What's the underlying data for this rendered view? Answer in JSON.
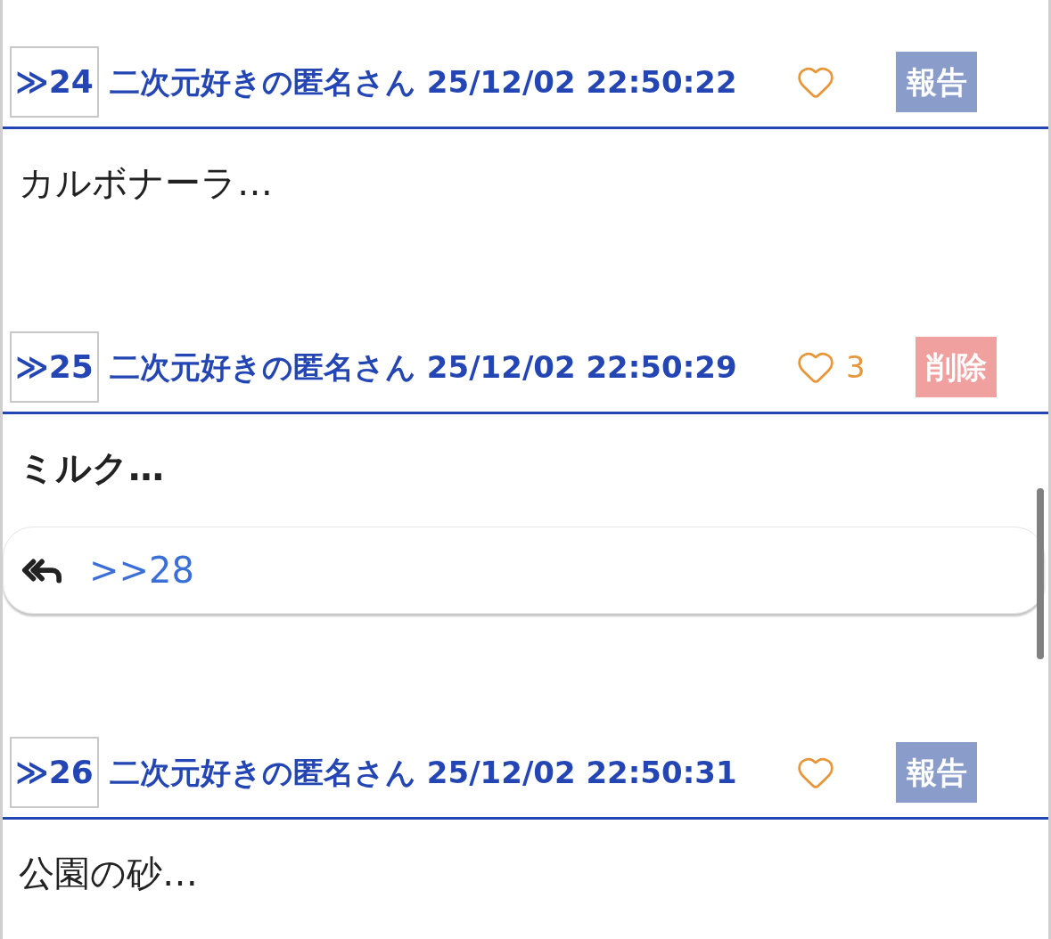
{
  "posts": [
    {
      "number": "≫24",
      "author_time": "二次元好きの匿名さん 25/12/02 22:50:22",
      "action": {
        "kind": "report",
        "label": "報告"
      },
      "body": "カルボナーラ…",
      "bold": false
    },
    {
      "number": "≫25",
      "author_time": "二次元好きの匿名さん 25/12/02 22:50:29",
      "likes": "3",
      "action": {
        "kind": "delete",
        "label": "削除"
      },
      "body": "ミルク…",
      "bold": true,
      "replies": [
        ">>28"
      ]
    },
    {
      "number": "≫26",
      "author_time": "二次元好きの匿名さん 25/12/02 22:50:31",
      "action": {
        "kind": "report",
        "label": "報告"
      },
      "body": "公園の砂…",
      "bold": false
    }
  ]
}
